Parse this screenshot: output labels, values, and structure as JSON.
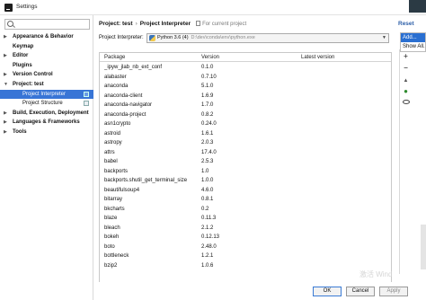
{
  "window": {
    "title": "Settings"
  },
  "sidebar": {
    "search_placeholder": "",
    "items": [
      {
        "label": "Appearance & Behavior",
        "arrow": "▶",
        "bold": true,
        "indent": 0
      },
      {
        "label": "Keymap",
        "arrow": "",
        "bold": true,
        "indent": 0
      },
      {
        "label": "Editor",
        "arrow": "▶",
        "bold": true,
        "indent": 0
      },
      {
        "label": "Plugins",
        "arrow": "",
        "bold": true,
        "indent": 0
      },
      {
        "label": "Version Control",
        "arrow": "▶",
        "bold": true,
        "indent": 0
      },
      {
        "label": "Project: test",
        "arrow": "▼",
        "bold": true,
        "indent": 0
      },
      {
        "label": "Project Interpreter",
        "arrow": "",
        "bold": false,
        "indent": 1,
        "selected": true
      },
      {
        "label": "Project Structure",
        "arrow": "",
        "bold": false,
        "indent": 1
      },
      {
        "label": "Build, Execution, Deployment",
        "arrow": "▶",
        "bold": true,
        "indent": 0
      },
      {
        "label": "Languages & Frameworks",
        "arrow": "▶",
        "bold": true,
        "indent": 0
      },
      {
        "label": "Tools",
        "arrow": "▶",
        "bold": true,
        "indent": 0
      }
    ]
  },
  "breadcrumb": {
    "project": "Project: test",
    "separator": "›",
    "page": "Project Interpreter",
    "note": "For current project"
  },
  "interpreter": {
    "label": "Project Interpreter:",
    "value": "Python 3.6 (4)",
    "path": "D:\\dev\\conda\\env\\python.exe"
  },
  "reset_label": "Reset",
  "popup": {
    "items": [
      "Add...",
      "Show All..."
    ]
  },
  "table": {
    "columns": [
      "Package",
      "Version",
      "Latest version"
    ],
    "rows": [
      [
        "_ipyw_jlab_nb_ext_conf",
        "0.1.0",
        ""
      ],
      [
        "alabaster",
        "0.7.10",
        ""
      ],
      [
        "anaconda",
        "5.1.0",
        ""
      ],
      [
        "anaconda-client",
        "1.6.9",
        ""
      ],
      [
        "anaconda-navigator",
        "1.7.0",
        ""
      ],
      [
        "anaconda-project",
        "0.8.2",
        ""
      ],
      [
        "asn1crypto",
        "0.24.0",
        ""
      ],
      [
        "astroid",
        "1.6.1",
        ""
      ],
      [
        "astropy",
        "2.0.3",
        ""
      ],
      [
        "attrs",
        "17.4.0",
        ""
      ],
      [
        "babel",
        "2.5.3",
        ""
      ],
      [
        "backports",
        "1.0",
        ""
      ],
      [
        "backports.shutil_get_terminal_size",
        "1.0.0",
        ""
      ],
      [
        "beautifulsoup4",
        "4.6.0",
        ""
      ],
      [
        "bitarray",
        "0.8.1",
        ""
      ],
      [
        "bkcharts",
        "0.2",
        ""
      ],
      [
        "blaze",
        "0.11.3",
        ""
      ],
      [
        "bleach",
        "2.1.2",
        ""
      ],
      [
        "bokeh",
        "0.12.13",
        ""
      ],
      [
        "boto",
        "2.48.0",
        ""
      ],
      [
        "bottleneck",
        "1.2.1",
        ""
      ],
      [
        "bzip2",
        "1.0.6",
        ""
      ]
    ]
  },
  "toolbar": {
    "add": "+",
    "remove": "−",
    "upgrade": "▲"
  },
  "buttons": {
    "ok": "OK",
    "cancel": "Cancel",
    "apply": "Apply"
  },
  "watermark": "激活 Wind"
}
